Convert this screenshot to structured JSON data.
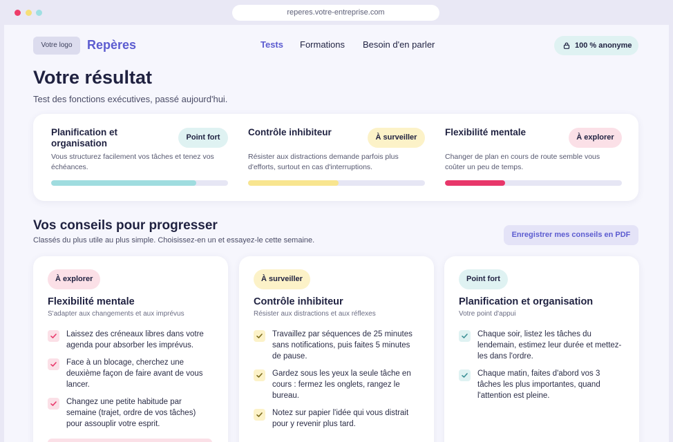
{
  "browser": {
    "url": "reperes.votre-entreprise.com"
  },
  "header": {
    "logo_placeholder": "Votre logo",
    "brand": "Repères",
    "nav": [
      "Tests",
      "Formations",
      "Besoin d'en parler"
    ],
    "anonymous_badge": "100 % anonyme"
  },
  "result": {
    "title": "Votre résultat",
    "subtitle": "Test des fonctions exécutives, passé aujourd'hui.",
    "items": [
      {
        "title": "Planification et organisation",
        "badge": "Point fort",
        "description": "Vous structurez facilement vos tâches et tenez vos échéances.",
        "level": 0.82
      },
      {
        "title": "Contrôle inhibiteur",
        "badge": "À surveiller",
        "description": "Résister aux distractions demande parfois plus d'efforts, surtout en cas d'interruptions.",
        "level": 0.51
      },
      {
        "title": "Flexibilité mentale",
        "badge": "À explorer",
        "description": "Changer de plan en cours de route semble vous coûter un peu de temps.",
        "level": 0.34
      }
    ]
  },
  "tips": {
    "title": "Vos conseils pour progresser",
    "subtitle": "Classés du plus utile au plus simple. Choisissez-en un et essayez-le cette semaine.",
    "pdf_button": "Enregistrer mes conseils en PDF",
    "cards": [
      {
        "badge": "À explorer",
        "title": "Flexibilité mentale",
        "subtitle": "S'adapter aux changements et aux imprévus",
        "items": [
          "Laissez des créneaux libres dans votre agenda pour absorber les imprévus.",
          "Face à un blocage, cherchez une deuxième façon de faire avant de vous lancer.",
          "Changez une petite habitude par semaine (trajet, ordre de vos tâches) pour assouplir votre esprit."
        ]
      },
      {
        "badge": "À surveiller",
        "title": "Contrôle inhibiteur",
        "subtitle": "Résister aux distractions et aux réflexes",
        "items": [
          "Travaillez par séquences de 25 minutes sans notifications, puis faites 5 minutes de pause.",
          "Gardez sous les yeux la seule tâche en cours : fermez les onglets, rangez le bureau.",
          "Notez sur papier l'idée qui vous distrait pour y revenir plus tard."
        ]
      },
      {
        "badge": "Point fort",
        "title": "Planification et organisation",
        "subtitle": "Votre point d'appui",
        "items": [
          "Chaque soir, listez les tâches du lendemain, estimez leur durée et mettez-les dans l'ordre.",
          "Chaque matin, faites d'abord vos 3 tâches les plus importantes, quand l'attention est pleine."
        ]
      }
    ]
  },
  "colors": {
    "accent": "#5c5cd0",
    "point_fort": "#9fdcdf",
    "a_surveiller": "#f8e58f",
    "a_explorer": "#e8376a"
  }
}
